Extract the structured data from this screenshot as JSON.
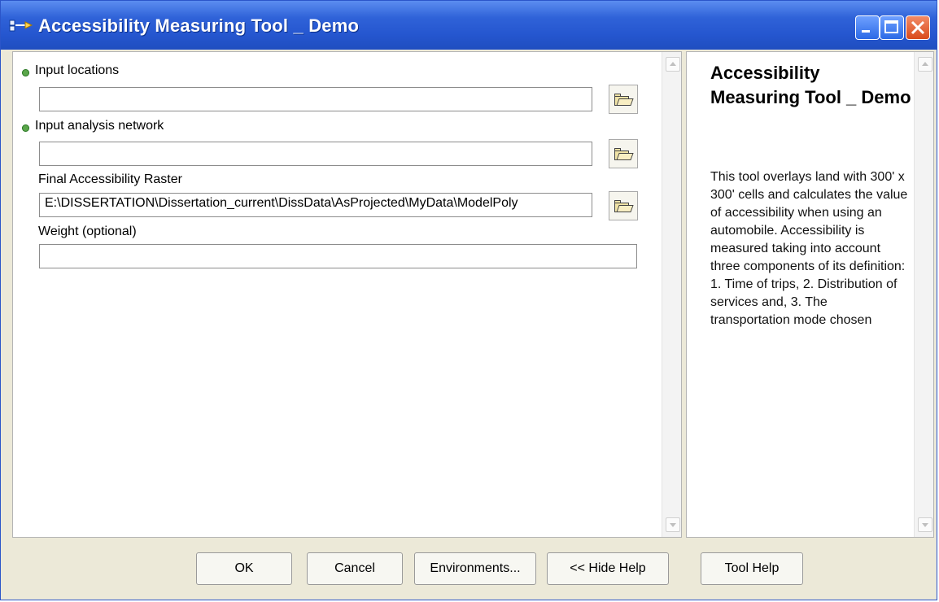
{
  "window": {
    "title": "Accessibility Measuring Tool _ Demo",
    "colors": {
      "titlebar": "#2556cf",
      "close_button": "#d94a1b",
      "required_dot": "#5aa64a"
    },
    "controls": {
      "minimize_icon": "minimize-icon",
      "maximize_icon": "maximize-icon",
      "close_icon": "close-icon"
    }
  },
  "form": {
    "fields": [
      {
        "label": "Input locations",
        "required": true,
        "value": ""
      },
      {
        "label": "Input analysis network",
        "required": true,
        "value": ""
      },
      {
        "label": "Final Accessibility Raster",
        "required": false,
        "value": "E:\\DISSERTATION\\Dissertation_current\\DissData\\AsProjected\\MyData\\ModelPoly"
      },
      {
        "label": "Weight (optional)",
        "required": false,
        "value": ""
      }
    ]
  },
  "help": {
    "title": "Accessibility Measuring Tool _ Demo",
    "body": "This tool overlays land with 300' x 300' cells and calculates the value of accessibility when using an automobile. Accessibility is measured taking into account three components of its definition: 1. Time of trips, 2. Distribution of services and, 3. The transportation mode chosen"
  },
  "buttons": {
    "ok": "OK",
    "cancel": "Cancel",
    "environments": "Environments...",
    "hide_help": "<< Hide Help",
    "tool_help": "Tool Help"
  }
}
